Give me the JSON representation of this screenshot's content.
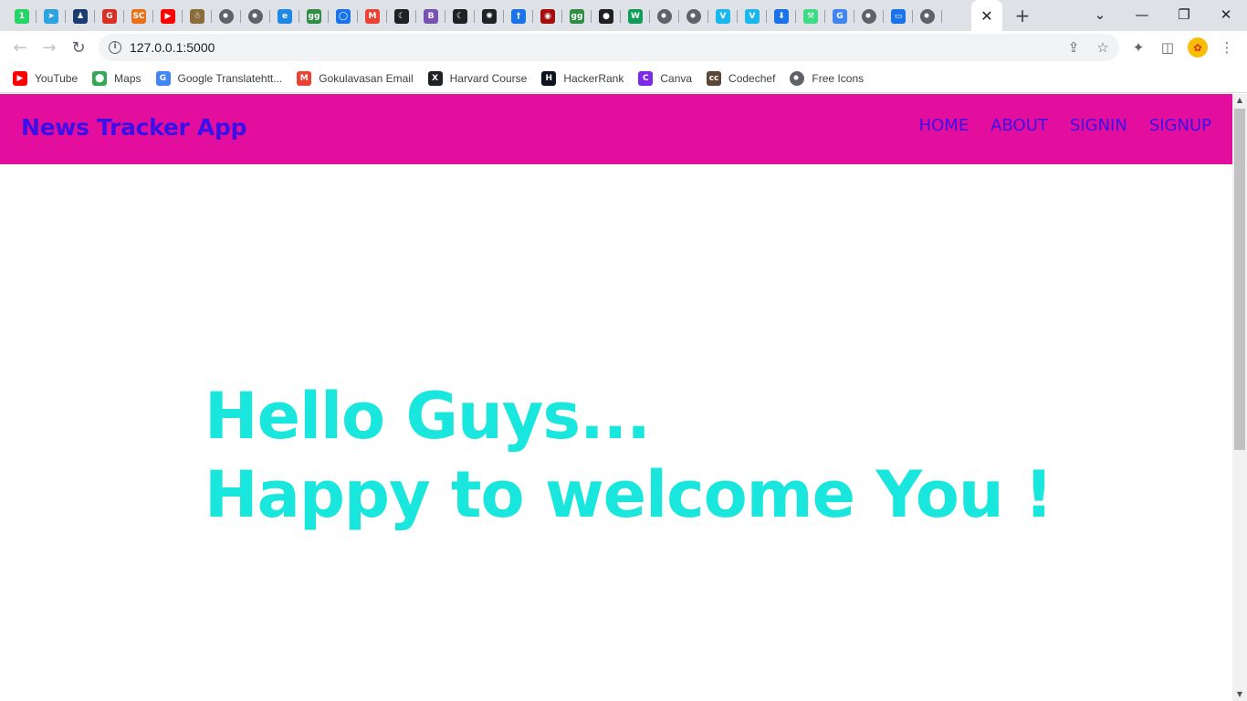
{
  "browser": {
    "tabs": [
      {
        "icon": "whatsapp-icon",
        "glyph": "1",
        "color": "#25d366"
      },
      {
        "icon": "telegram-icon",
        "glyph": "➤",
        "color": "#2aa3e0"
      },
      {
        "icon": "student-icon",
        "glyph": "♟",
        "color": "#1a3c6e"
      },
      {
        "icon": "google-red-icon",
        "glyph": "G",
        "color": "#d93025"
      },
      {
        "icon": "sc-icon",
        "glyph": "SC",
        "color": "#e8711a"
      },
      {
        "icon": "youtube-icon",
        "glyph": "▶",
        "color": "#ff0000"
      },
      {
        "icon": "app-icon",
        "glyph": "☃",
        "color": "#8a6d3b"
      },
      {
        "icon": "globe-icon",
        "glyph": "",
        "color": "#5f6368"
      },
      {
        "icon": "globe-icon",
        "glyph": "",
        "color": "#5f6368"
      },
      {
        "icon": "edge-icon",
        "glyph": "e",
        "color": "#1e88e5"
      },
      {
        "icon": "geeksforgeeks-icon",
        "glyph": "gg",
        "color": "#2f8d46"
      },
      {
        "icon": "chrome-ring-icon",
        "glyph": "◯",
        "color": "#1a73e8"
      },
      {
        "icon": "gmail-icon",
        "glyph": "M",
        "color": "#ea4335"
      },
      {
        "icon": "moon-icon",
        "glyph": "☾",
        "color": "#202124"
      },
      {
        "icon": "bootstrap-icon",
        "glyph": "B",
        "color": "#7952b3"
      },
      {
        "icon": "moon-icon",
        "glyph": "☾",
        "color": "#202124"
      },
      {
        "icon": "openai-icon",
        "glyph": "✺",
        "color": "#202124"
      },
      {
        "icon": "dagger-icon",
        "glyph": "†",
        "color": "#1a73e8"
      },
      {
        "icon": "seal-icon",
        "glyph": "◉",
        "color": "#a50e0e"
      },
      {
        "icon": "geeksforgeeks-icon",
        "glyph": "gg",
        "color": "#2f8d46"
      },
      {
        "icon": "github-icon",
        "glyph": "●",
        "color": "#202124"
      },
      {
        "icon": "w-icon",
        "glyph": "W",
        "color": "#0f9d58"
      },
      {
        "icon": "globe-icon",
        "glyph": "",
        "color": "#5f6368"
      },
      {
        "icon": "globe-icon",
        "glyph": "",
        "color": "#5f6368"
      },
      {
        "icon": "vimeo-icon",
        "glyph": "V",
        "color": "#1ab7ea"
      },
      {
        "icon": "vimeo-icon",
        "glyph": "V",
        "color": "#1ab7ea"
      },
      {
        "icon": "download-icon",
        "glyph": "⬇",
        "color": "#1a73e8"
      },
      {
        "icon": "android-tool-icon",
        "glyph": "⚒",
        "color": "#3ddc84"
      },
      {
        "icon": "google-icon",
        "glyph": "G",
        "color": "#4285f4"
      },
      {
        "icon": "globe-icon",
        "glyph": "",
        "color": "#5f6368"
      },
      {
        "icon": "monitor-icon",
        "glyph": "▭",
        "color": "#1a73e8"
      },
      {
        "icon": "globe-icon",
        "glyph": "",
        "color": "#5f6368"
      }
    ],
    "active_tab_close": "✕",
    "new_tab": "+",
    "window_controls": {
      "dropdown": "⌄",
      "minimize": "—",
      "restore": "❐",
      "close": "✕"
    },
    "nav": {
      "back": "←",
      "forward": "→",
      "reload": "↻"
    },
    "address": "127.0.0.1:5000",
    "site_info": "i",
    "share": "⇪",
    "star": "☆",
    "extensions": "✦",
    "side_panel": "◫",
    "menu": "⋮",
    "profile_glyph": "✿",
    "bookmarks": [
      {
        "label": "YouTube",
        "icon": "youtube-icon",
        "glyph": "▶",
        "color": "#ff0000"
      },
      {
        "label": "Maps",
        "icon": "maps-pin-icon",
        "glyph": "⬤",
        "color": "#34a853"
      },
      {
        "label": "Google Translatehtt...",
        "icon": "translate-icon",
        "glyph": "G",
        "color": "#4285f4"
      },
      {
        "label": "Gokulavasan Email",
        "icon": "gmail-icon",
        "glyph": "M",
        "color": "#ea4335"
      },
      {
        "label": "Harvard Course",
        "icon": "x-icon",
        "glyph": "X",
        "color": "#202124"
      },
      {
        "label": "HackerRank",
        "icon": "hackerrank-icon",
        "glyph": "H",
        "color": "#0e141e"
      },
      {
        "label": "Canva",
        "icon": "canva-icon",
        "glyph": "C",
        "color": "#7d2ae8"
      },
      {
        "label": "Codechef",
        "icon": "codechef-icon",
        "glyph": "cc",
        "color": "#5b4638"
      },
      {
        "label": "Free Icons",
        "icon": "globe-icon",
        "glyph": "",
        "color": "#5f6368"
      }
    ]
  },
  "page": {
    "brand": "News Tracker App",
    "nav_links": [
      "HOME",
      "ABOUT",
      "SIGNIN",
      "SIGNUP"
    ],
    "hero_line1": "Hello Guys...",
    "hero_line2": "Happy to welcome You !",
    "colors": {
      "navbar_bg": "#e30e9e",
      "brand_text": "#3a10e8",
      "hero_text": "#19e6dd"
    }
  }
}
